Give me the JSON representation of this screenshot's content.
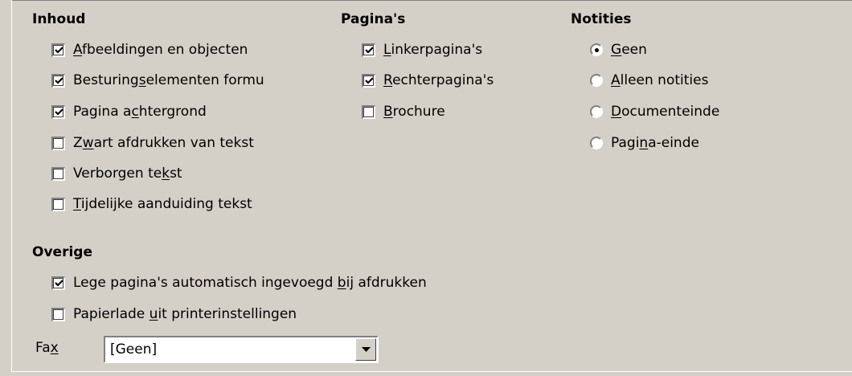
{
  "inhoud": {
    "heading": "Inhoud",
    "items": [
      {
        "pre": "",
        "acc": "A",
        "post": "fbeeldingen en objecten",
        "checked": true
      },
      {
        "pre": "Besturing",
        "acc": "s",
        "post": "elementen formu",
        "checked": true
      },
      {
        "pre": "Pagina a",
        "acc": "c",
        "post": "htergrond",
        "checked": true
      },
      {
        "pre": "Z",
        "acc": "w",
        "post": "art afdrukken van tekst",
        "checked": false
      },
      {
        "pre": "Verborgen te",
        "acc": "k",
        "post": "st",
        "checked": false
      },
      {
        "pre": "",
        "acc": "T",
        "post": "ijdelijke aanduiding tekst",
        "checked": false
      }
    ]
  },
  "paginas": {
    "heading": "Pagina's",
    "items": [
      {
        "pre": "",
        "acc": "L",
        "post": "inkerpagina's",
        "checked": true
      },
      {
        "pre": "",
        "acc": "R",
        "post": "echterpagina's",
        "checked": true
      },
      {
        "pre": "",
        "acc": "B",
        "post": "rochure",
        "checked": false
      }
    ]
  },
  "notities": {
    "heading": "Notities",
    "items": [
      {
        "pre": "",
        "acc": "G",
        "post": "een",
        "selected": true
      },
      {
        "pre": "",
        "acc": "A",
        "post": "lleen notities",
        "selected": false
      },
      {
        "pre": "",
        "acc": "D",
        "post": "ocumenteinde",
        "selected": false
      },
      {
        "pre": "Pagi",
        "acc": "n",
        "post": "a-einde",
        "selected": false
      }
    ]
  },
  "overige": {
    "heading": "Overige",
    "items": [
      {
        "pre": "Lege pagina's automatisch ingevoegd ",
        "acc": "b",
        "post": "ij afdrukken",
        "checked": true
      },
      {
        "pre": "Papierlade ",
        "acc": "u",
        "post": "it printerinstellingen",
        "checked": false
      }
    ]
  },
  "fax": {
    "label_pre": "Fa",
    "label_acc": "x",
    "value": "[Geen]"
  }
}
